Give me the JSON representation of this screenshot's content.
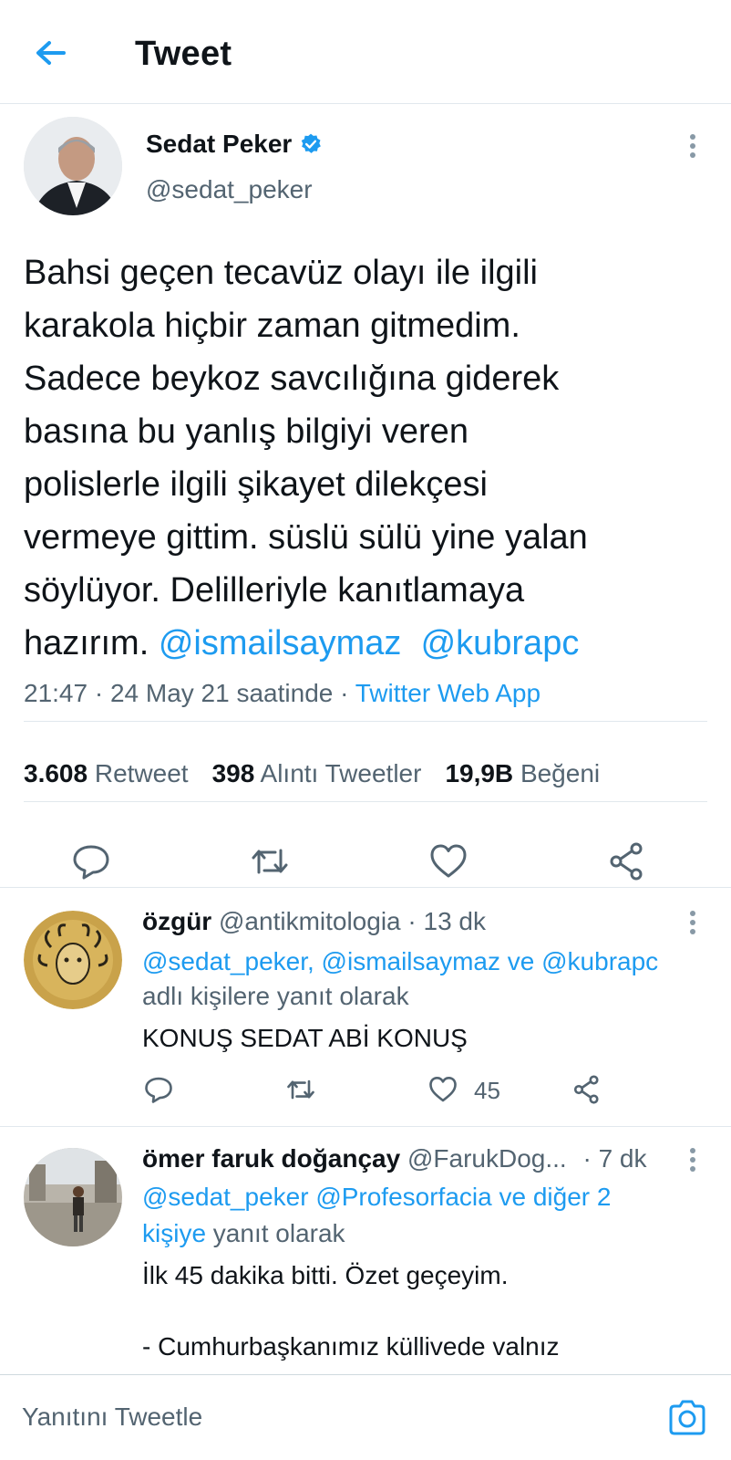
{
  "header": {
    "title": "Tweet",
    "back_icon": "arrow-left-icon"
  },
  "main_tweet": {
    "author_name": "Sedat Peker",
    "author_handle": "@sedat_peker",
    "text_lines": [
      "Bahsi geçen tecavüz olayı ile ilgili",
      "karakola hiçbir zaman gitmedim.",
      "Sadece beykoz savcılığına giderek",
      "basına bu yanlış bilgiyi veren",
      "polislerle ilgili şikayet dilekçesi",
      "vermeye gittim. süslü sülü yine yalan",
      "söylüyor. Delilleriyle kanıtlamaya"
    ],
    "last_line_text": "hazırım.",
    "mention_1": "@ismailsaymaz",
    "mention_2": "@kubrapc",
    "timestamp": "21:47 · 24 May 21 saatinde · ",
    "source": "Twitter Web App",
    "stats": {
      "retweets": "3.608",
      "retweets_label": "Retweet",
      "quotes": "398",
      "quotes_label": "Alıntı Tweetler",
      "likes": "19,9B",
      "likes_label": "Beğeni"
    }
  },
  "replies": [
    {
      "name": "özgür",
      "handle": "@antikmitologia",
      "time": " · 13 dk",
      "mentions": "@sedat_peker, @ismailsaymaz ve @kubrapc",
      "reply_context": "adlı kişilere yanıt olarak",
      "text": "KONUŞ SEDAT ABİ KONUŞ",
      "like_count": "45"
    },
    {
      "name": "ömer faruk doğançay",
      "handle": "@FarukDog...",
      "time": " · 7 dk",
      "mentions_line1": "@sedat_peker @Profesorfacia ve diğer 2",
      "mentions_line2": "kişiye",
      "reply_context": " yanıt olarak",
      "text": "İlk 45 dakika bitti. Özet geçeyim.",
      "text_cutoff": "- Cumhurbaşkanımız küllivede valnız"
    }
  ],
  "compose": {
    "placeholder": "Yanıtını Tweetle",
    "camera_icon": "camera-icon"
  },
  "colors": {
    "accent": "#1d9bf0",
    "text": "#0f1419",
    "secondary": "#536471",
    "divider": "#e1e8ed"
  }
}
